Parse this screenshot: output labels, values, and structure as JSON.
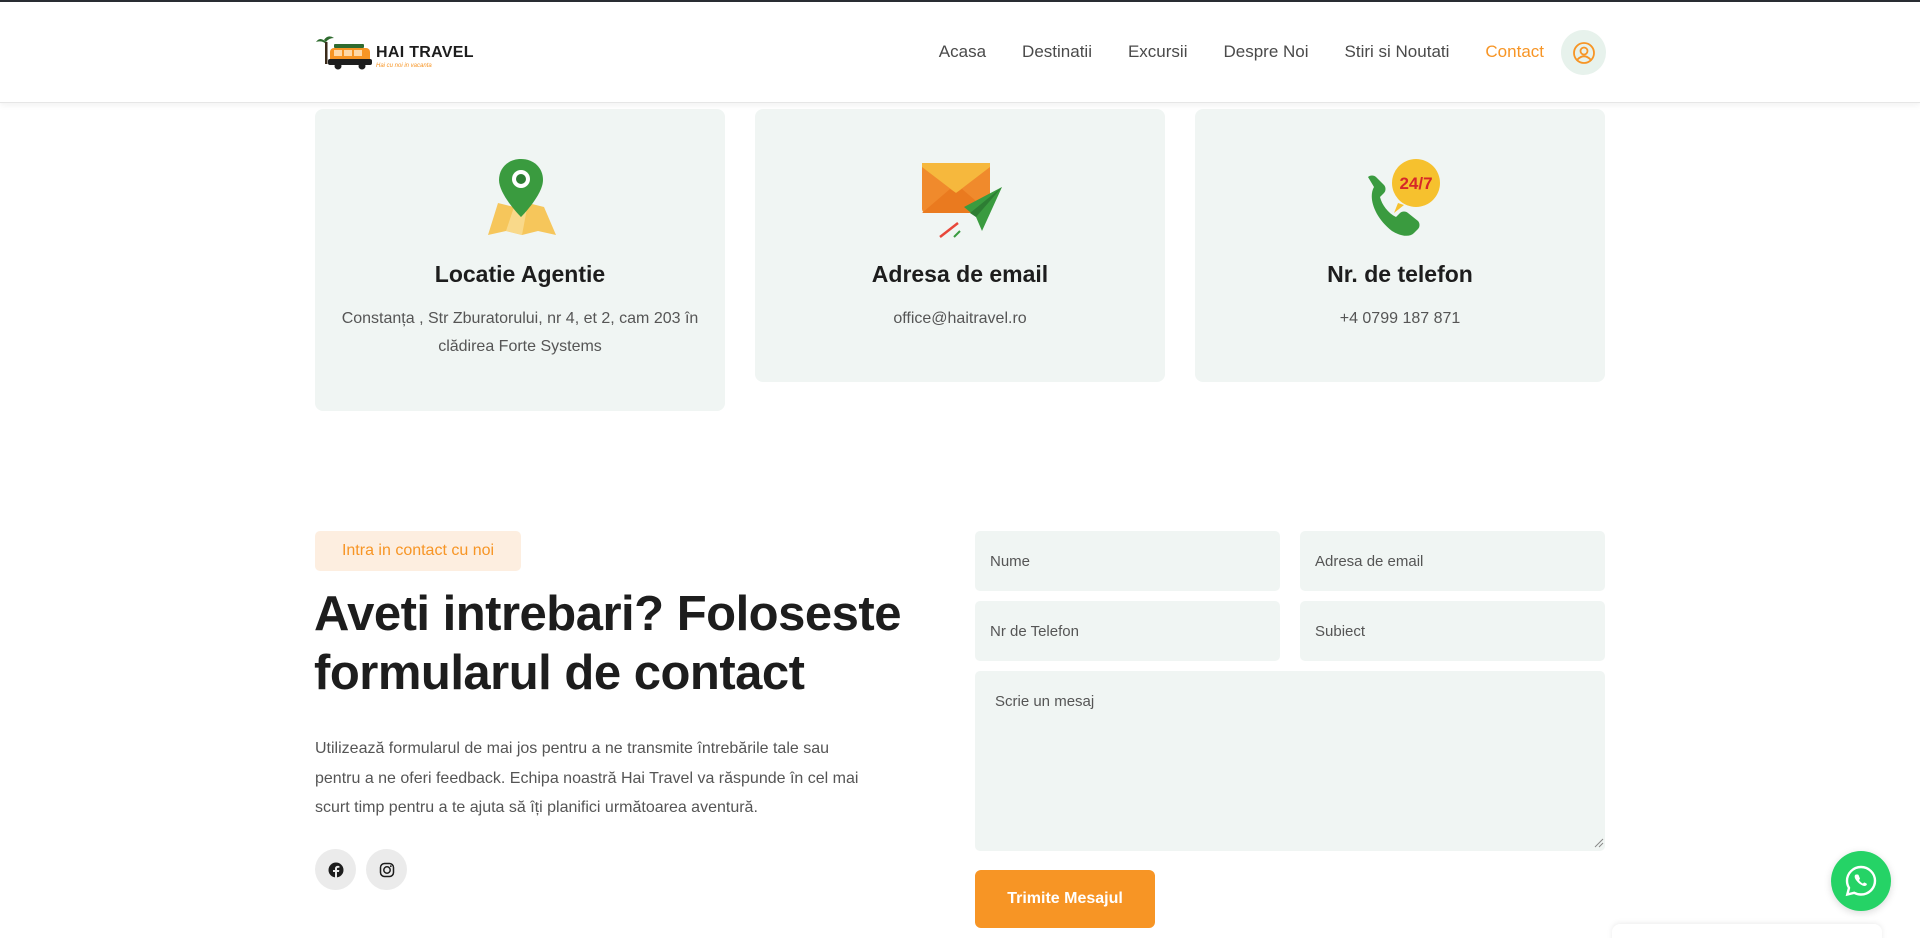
{
  "header": {
    "logo_text": "HAI TRAVEL",
    "logo_tagline": "Hai cu noi in vacanta",
    "nav": [
      "Acasa",
      "Destinatii",
      "Excursii",
      "Despre Noi",
      "Stiri si Noutati",
      "Contact"
    ],
    "active_nav": "Contact"
  },
  "cards": [
    {
      "icon": "map-pin-icon",
      "title": "Locatie Agentie",
      "text": "Constanța , Str Zburatorului, nr 4, et 2, cam 203 în clădirea Forte Systems"
    },
    {
      "icon": "email-icon",
      "title": "Adresa de email",
      "text": "office@haitravel.ro"
    },
    {
      "icon": "phone-24-7-icon",
      "title": "Nr. de telefon",
      "text": "+4 0799 187 871"
    }
  ],
  "phone_badge": "24/7",
  "contact": {
    "badge": "Intra in contact cu noi",
    "headline": "Aveti intrebari? Foloseste formularul de contact",
    "description": "Utilizează formularul de mai jos pentru a ne transmite întrebările tale sau pentru a ne oferi feedback. Echipa noastră Hai Travel va răspunde în cel mai scurt timp pentru a te ajuta să îți planifici următoarea aventură.",
    "social": [
      "facebook-icon",
      "instagram-icon"
    ]
  },
  "form": {
    "name_placeholder": "Nume",
    "email_placeholder": "Adresa de email",
    "phone_placeholder": "Nr de Telefon",
    "subject_placeholder": "Subiect",
    "message_placeholder": "Scrie un mesaj",
    "submit_label": "Trimite Mesajul"
  },
  "colors": {
    "accent": "#f79525",
    "card_bg": "#f0f5f3",
    "whatsapp": "#25d366",
    "dark": "#1d1d1d"
  }
}
